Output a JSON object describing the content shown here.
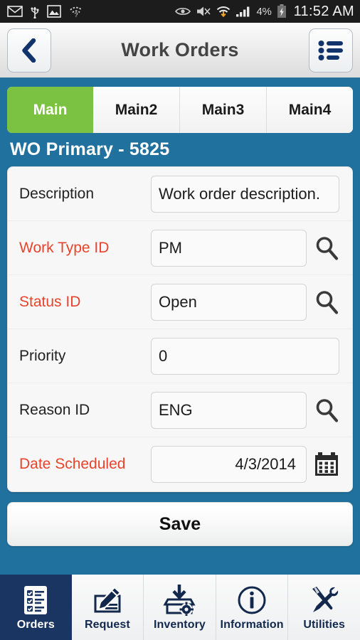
{
  "statusbar": {
    "icons_left": [
      "mail-icon",
      "usb-icon",
      "image-icon",
      "wifi-question-icon"
    ],
    "icons_right": [
      "eye-icon",
      "mute-icon",
      "wifi-download-icon",
      "signal-icon"
    ],
    "battery_percent": "4%",
    "battery_state": "charging-battery-icon",
    "time": "11:52 AM"
  },
  "header": {
    "back_icon": "chevron-left-icon",
    "title": "Work Orders",
    "menu_icon": "list-icon"
  },
  "tabs": [
    {
      "label": "Main",
      "active": true
    },
    {
      "label": "Main2",
      "active": false
    },
    {
      "label": "Main3",
      "active": false
    },
    {
      "label": "Main4",
      "active": false
    }
  ],
  "section": {
    "title": "WO Primary - 5825"
  },
  "form": {
    "rows": [
      {
        "label": "Description",
        "required": false,
        "value": "Work order description.",
        "icon": "none",
        "align": "left"
      },
      {
        "label": "Work Type ID",
        "required": true,
        "value": "PM",
        "icon": "search-icon",
        "align": "left"
      },
      {
        "label": "Status ID",
        "required": true,
        "value": "Open",
        "icon": "search-icon",
        "align": "left"
      },
      {
        "label": "Priority",
        "required": false,
        "value": "0",
        "icon": "none",
        "align": "left"
      },
      {
        "label": "Reason ID",
        "required": false,
        "value": "ENG",
        "icon": "search-icon",
        "align": "left"
      },
      {
        "label": "Date Scheduled",
        "required": true,
        "value": "4/3/2014",
        "icon": "calendar-icon",
        "align": "right"
      }
    ]
  },
  "actions": {
    "save_label": "Save"
  },
  "bottomnav": [
    {
      "label": "Orders",
      "icon": "checklist-icon",
      "active": true
    },
    {
      "label": "Request",
      "icon": "pencil-form-icon",
      "active": false
    },
    {
      "label": "Inventory",
      "icon": "box-gear-icon",
      "active": false
    },
    {
      "label": "Information",
      "icon": "info-circle-icon",
      "active": false
    },
    {
      "label": "Utilities",
      "icon": "tools-icon",
      "active": false
    }
  ],
  "colors": {
    "background": "#20719e",
    "tab_active": "#7cc242",
    "required_label": "#e8432c",
    "nav_active": "#1b3562",
    "navy": "#12284c",
    "statusbar": "#1c1c1c"
  }
}
